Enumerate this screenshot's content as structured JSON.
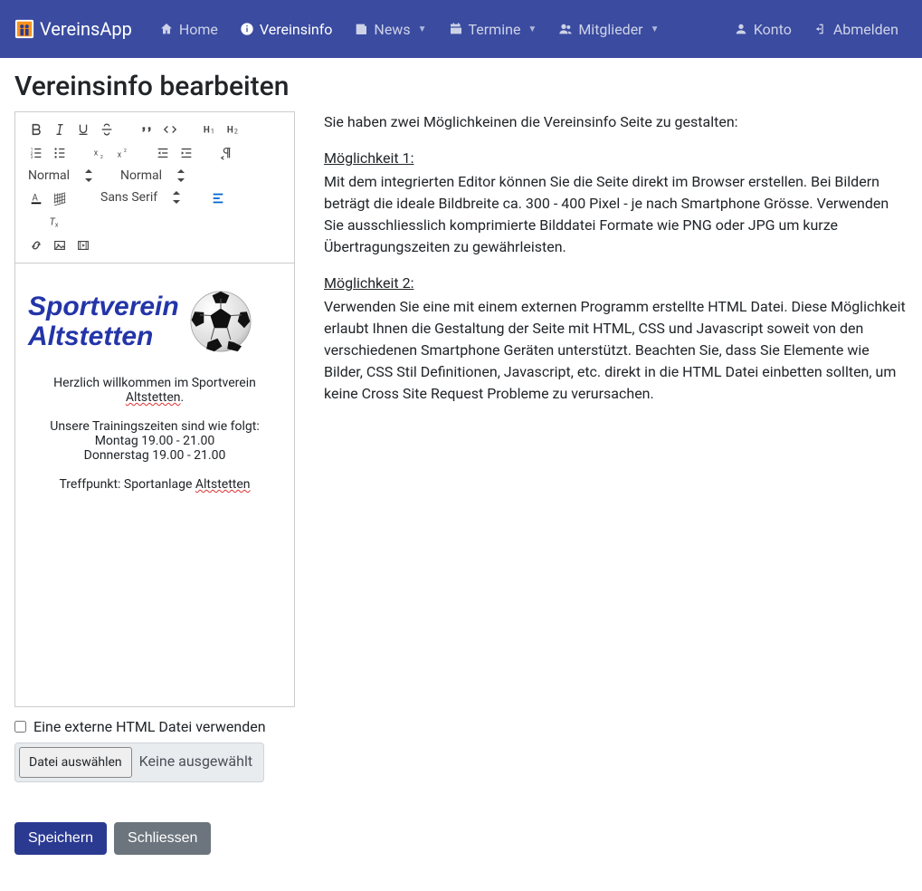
{
  "brand": "VereinsApp",
  "nav": {
    "home": "Home",
    "vereinsinfo": "Vereinsinfo",
    "news": "News",
    "termine": "Termine",
    "mitglieder": "Mitglieder",
    "konto": "Konto",
    "abmelden": "Abmelden"
  },
  "title": "Vereinsinfo bearbeiten",
  "toolbar": {
    "size_picker": "Normal",
    "header_picker": "Normal",
    "font_picker": "Sans Serif"
  },
  "editor": {
    "club_line1": "Sportverein",
    "club_line2": "Altstetten",
    "welcome_pre": "Herzlich willkommen im Sportverein ",
    "welcome_place": "Altstetten",
    "welcome_post": ".",
    "train_intro": "Unsere Trainingszeiten sind wie folgt:",
    "train1": "Montag 19.00 - 21.00",
    "train2": "Donnerstag 19.00 - 21.00",
    "meeting_pre": "Treffpunkt: Sportanlage ",
    "meeting_place": "Altstetten"
  },
  "external": {
    "checkbox_label": "Eine externe HTML Datei verwenden",
    "choose": "Datei auswählen",
    "none": "Keine ausgewählt"
  },
  "buttons": {
    "save": "Speichern",
    "close": "Schliessen"
  },
  "help": {
    "intro": "Sie haben zwei Möglichkeinen die Vereinsinfo Seite zu gestalten:",
    "opt1_head": "Möglichkeit 1:",
    "opt1_body": "Mit dem integrierten Editor können Sie die Seite direkt im Browser erstellen. Bei Bildern beträgt die ideale Bildbreite ca. 300 - 400 Pixel - je nach Smartphone Grösse. Verwenden Sie ausschliesslich komprimierte Bilddatei Formate wie PNG oder JPG um kurze Übertragungszeiten zu gewährleisten.",
    "opt2_head": "Möglichkeit 2:",
    "opt2_body": "Verwenden Sie eine mit einem externen Programm erstellte HTML Datei. Diese Möglichkeit erlaubt Ihnen die Gestaltung der Seite mit HTML, CSS und Javascript soweit von den verschiedenen Smartphone Geräten unterstützt. Beachten Sie, dass Sie Elemente wie Bilder, CSS Stil Definitionen, Javascript, etc. direkt in die HTML Datei einbetten sollten, um keine Cross Site Request Probleme zu verursachen."
  }
}
